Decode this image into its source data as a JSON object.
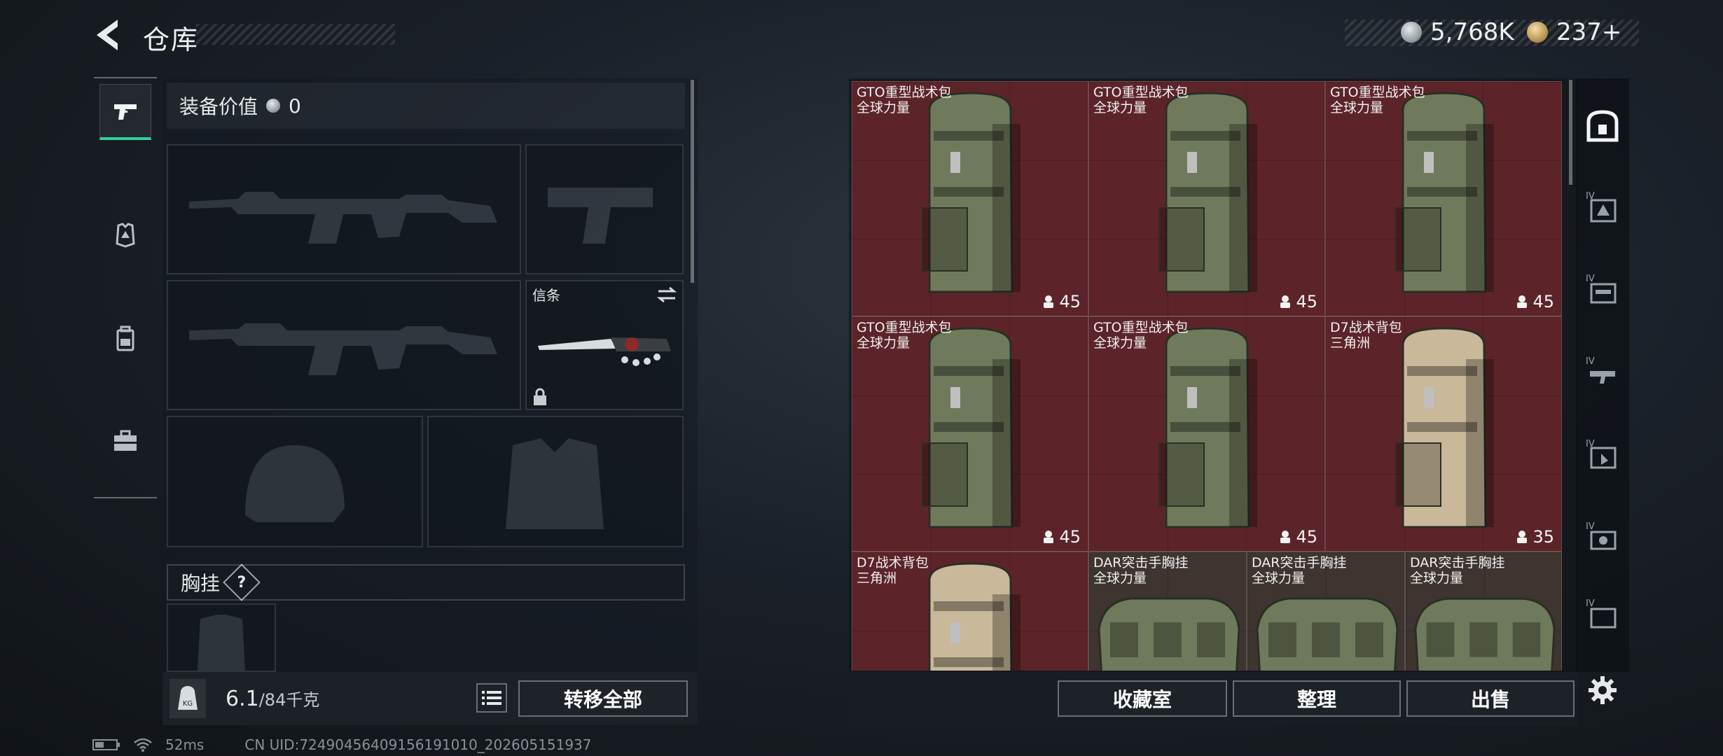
{
  "header": {
    "title": "仓库",
    "currency_silver": "5,768K",
    "currency_gold": "237+"
  },
  "equip": {
    "value_label": "装备价值",
    "value": "0",
    "melee_label": "信条",
    "chest_label": "胸挂",
    "help": "?",
    "weight_value": "6.1",
    "weight_max": "/84千克",
    "transfer_all": "转移全部"
  },
  "items": [
    {
      "name": "GTO重型战术包",
      "source": "全球力量",
      "capacity": "45"
    },
    {
      "name": "GTO重型战术包",
      "source": "全球力量",
      "capacity": "45"
    },
    {
      "name": "GTO重型战术包",
      "source": "全球力量",
      "capacity": "45"
    },
    {
      "name": "GTO重型战术包",
      "source": "全球力量",
      "capacity": "45"
    },
    {
      "name": "GTO重型战术包",
      "source": "全球力量",
      "capacity": "45"
    },
    {
      "name": "D7战术背包",
      "source": "三角洲",
      "capacity": "35"
    },
    {
      "name": "D7战术背包",
      "source": "三角洲",
      "capacity": ""
    },
    {
      "name": "DAR突击手胸挂",
      "source": "全球力量",
      "capacity": ""
    },
    {
      "name": "DAR突击手胸挂",
      "source": "全球力量",
      "capacity": ""
    },
    {
      "name": "DAR突击手胸挂",
      "source": "全球力量",
      "capacity": ""
    }
  ],
  "footer": {
    "collection": "收藏室",
    "sort": "整理",
    "sell": "出售"
  },
  "status": {
    "ping": "52ms",
    "uid": "CN UID:72490456409156191010_202605151937"
  },
  "colors": {
    "accent": "#2fd3a0",
    "cell_red": "#5c2429",
    "cell_brown": "#3e3530",
    "pack_green": "#6f7a5c",
    "pack_tan": "#c9b89a"
  },
  "icons": [
    "back-arrow-icon",
    "pistol-icon",
    "armor-icon",
    "backpack-icon",
    "toolbox-icon",
    "lock-icon",
    "swap-icon",
    "weight-icon",
    "list-icon",
    "helmet-ghost-icon",
    "gear-icon",
    "safe-icon"
  ]
}
